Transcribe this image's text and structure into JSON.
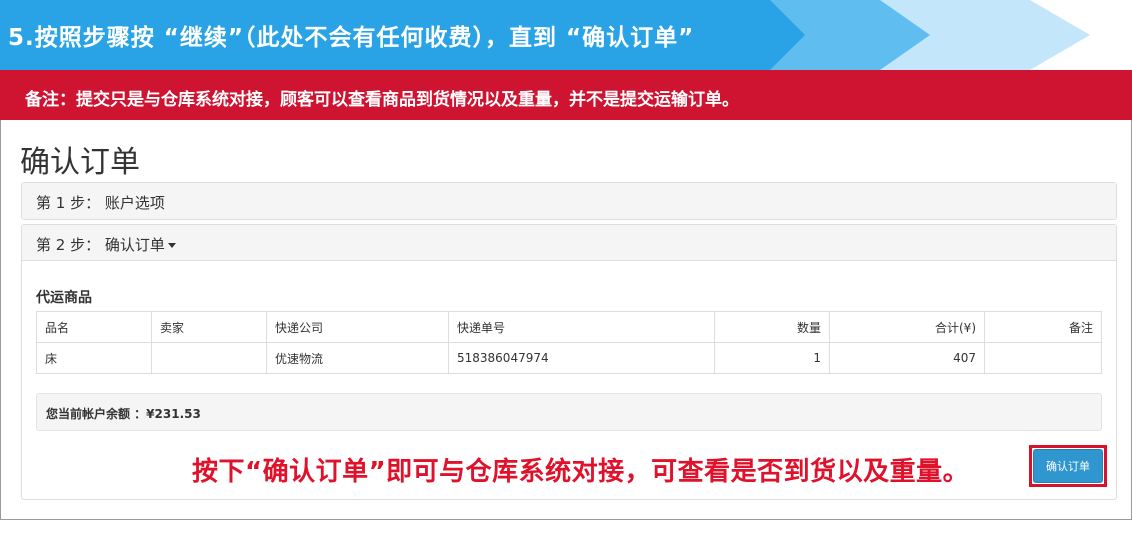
{
  "banner": {
    "step_title": "5.按照步骤按 “继续”（此处不会有任何收费），直到 “确认订单”"
  },
  "note": {
    "text": "备注：提交只是与仓库系统对接，顾客可以查看商品到货情况以及重量，并不是提交运输订单。"
  },
  "page": {
    "title": "确认订单"
  },
  "step1": {
    "label": "第 1 步： 账户选项"
  },
  "step2": {
    "label": "第 2 步： 确认订单"
  },
  "goods": {
    "section_title": "代运商品",
    "columns": [
      "品名",
      "卖家",
      "快递公司",
      "快递单号",
      "数量",
      "合计(¥)",
      "备注"
    ],
    "rows": [
      [
        "床",
        "",
        "优速物流",
        "518386047974",
        "1",
        "407",
        ""
      ]
    ]
  },
  "balance": {
    "text": "您当前帐户余额 ：¥231.53"
  },
  "callout": {
    "text": "按下“确认订单”即可与仓库系统对接，可查看是否到货以及重量。"
  },
  "confirm_button": {
    "label": "确认订单"
  },
  "colors": {
    "banner_blue": "#2aa3e6",
    "note_red": "#cf1432",
    "callout_red": "#e0122b",
    "button_blue": "#2f96d0"
  }
}
